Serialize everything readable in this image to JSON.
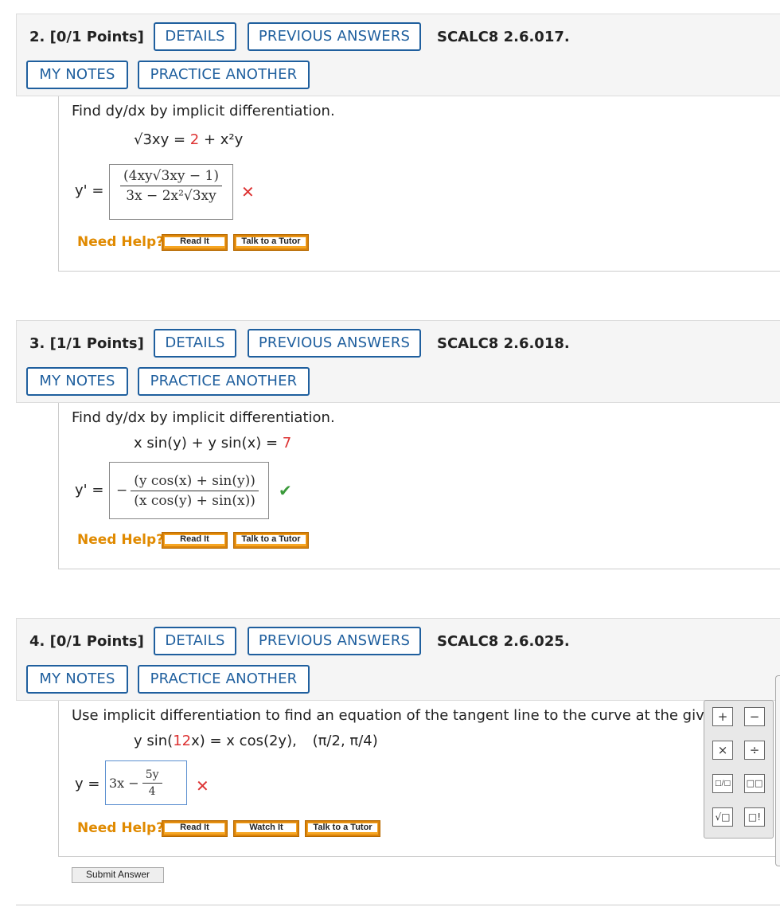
{
  "questions": [
    {
      "number": "2. [0/1 Points]",
      "details": "DETAILS",
      "previous": "PREVIOUS ANSWERS",
      "code": "SCALC8 2.6.017.",
      "notes": "MY NOTES",
      "practice": "PRACTICE ANOTHER",
      "prompt": "Find dy/dx by implicit differentiation.",
      "equation_left": "√3xy",
      "equation_eq": " = ",
      "equation_const": "2",
      "equation_right": " + x²y",
      "answer_label": "y' =",
      "answer_num": "(4xy√3xy − 1)",
      "answer_den": "3x − 2x²√3xy",
      "result": "incorrect",
      "need_help": "Need Help?",
      "help_buttons": [
        "Read It",
        "Talk to a Tutor"
      ]
    },
    {
      "number": "3. [1/1 Points]",
      "details": "DETAILS",
      "previous": "PREVIOUS ANSWERS",
      "code": "SCALC8 2.6.018.",
      "notes": "MY NOTES",
      "practice": "PRACTICE ANOTHER",
      "prompt": "Find dy/dx by implicit differentiation.",
      "equation_left": "x sin(y) + y sin(x)",
      "equation_eq": " = ",
      "equation_const": "7",
      "answer_label": "y' =",
      "answer_sign": "−",
      "answer_num": "(y cos(x) + sin(y))",
      "answer_den": "(x cos(y) + sin(x))",
      "result": "correct",
      "need_help": "Need Help?",
      "help_buttons": [
        "Read It",
        "Talk to a Tutor"
      ]
    },
    {
      "number": "4. [0/1 Points]",
      "details": "DETAILS",
      "previous": "PREVIOUS ANSWERS",
      "code": "SCALC8 2.6.025.",
      "notes": "MY NOTES",
      "practice": "PRACTICE ANOTHER",
      "prompt": "Use implicit differentiation to find an equation of the tangent line to the curve at the giv",
      "equation_a": "y sin(",
      "equation_const": "12",
      "equation_b": "x) = x cos(2y),",
      "point": "(π/2, π/4)",
      "answer_label": "y =",
      "answer_prefix": "3x −",
      "answer_num": "5y",
      "answer_den": "4",
      "result": "incorrect",
      "need_help": "Need Help?",
      "help_buttons": [
        "Read It",
        "Watch It",
        "Talk to a Tutor"
      ],
      "submit": "Submit Answer"
    }
  ],
  "keypad": {
    "keys": [
      "+",
      "−",
      "×",
      "÷",
      "□/□",
      "□□",
      "√□",
      "□!"
    ]
  },
  "marks": {
    "incorrect": "✕",
    "correct": "✔"
  }
}
